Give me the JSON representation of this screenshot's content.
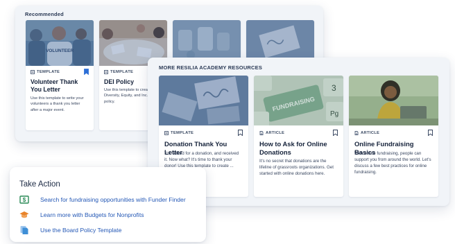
{
  "recommended": {
    "title": "Recommended",
    "cards": [
      {
        "type": "TEMPLATE",
        "title": "Volunteer Thank You Letter",
        "desc": "Use this template to write your volunteers a thank you letter after a major event.",
        "image_text": "VOLUNTEER",
        "bookmarked": true
      },
      {
        "type": "TEMPLATE",
        "title": "DEI Policy",
        "desc": "Use this template to crea... Diversity, Equity, and Inc... policy.",
        "bookmarked": false
      },
      {
        "type": "",
        "title": "",
        "desc": ""
      },
      {
        "type": "",
        "title": "",
        "desc": ""
      }
    ]
  },
  "resources": {
    "title": "MORE RESILIA ACADEMY RESOURCES",
    "cards": [
      {
        "type": "TEMPLATE",
        "title": "Donation Thank You Letter",
        "desc": "You asked for a donation, and received it. Now what? It's time to thank your donor! Use this template to create ... thank you letter.",
        "bookmarked": false
      },
      {
        "type": "ARTICLE",
        "title": "How to Ask for Online Donations",
        "desc": "It's no secret that donations are the lifeline of grassroots organizations. Get started with online donations here.",
        "image_text": "FUNDRAISING",
        "bookmarked": false
      },
      {
        "type": "ARTICLE",
        "title": "Online Fundraising Basics",
        "desc": "With online fundraising, people can support you from around the world. Let's discuss a few best practices for online fundraising.",
        "bookmarked": false
      }
    ]
  },
  "take_action": {
    "title": "Take Action",
    "items": [
      {
        "label": "Search for fundraising opportunities with Funder Finder",
        "icon": "dollar-bill-icon",
        "color": "#2a8a57"
      },
      {
        "label": "Learn more with Budgets for Nonprofits",
        "icon": "graduation-cap-icon",
        "color": "#e8842b"
      },
      {
        "label": "Use the Board Policy Template",
        "icon": "documents-icon",
        "color": "#3f8fd6"
      }
    ]
  },
  "colors": {
    "accent": "#2357b5",
    "overlay": "#2a4f8c"
  }
}
